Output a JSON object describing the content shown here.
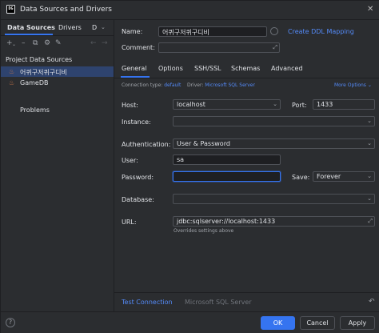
{
  "window": {
    "title": "Data Sources and Drivers",
    "app_icon_text": "DG"
  },
  "left": {
    "tabs": [
      "Data Sources",
      "Drivers",
      "D"
    ],
    "section_label": "Project Data Sources",
    "items": [
      {
        "label": "어퀴구저퀴구디비",
        "selected": true
      },
      {
        "label": "GameDB",
        "selected": false
      }
    ],
    "problems_label": "Problems"
  },
  "form": {
    "name_label": "Name:",
    "name_value": "어퀴구저퀴구디비",
    "create_ddl_link": "Create DDL Mapping",
    "comment_label": "Comment:",
    "comment_value": "",
    "tabs": [
      "General",
      "Options",
      "SSH/SSL",
      "Schemas",
      "Advanced"
    ],
    "active_tab": "General",
    "connection_type_label": "Connection type:",
    "connection_type_value": "default",
    "driver_label": "Driver:",
    "driver_value": "Microsoft SQL Server",
    "more_options": "More Options",
    "host_label": "Host:",
    "host_value": "localhost",
    "port_label": "Port:",
    "port_value": "1433",
    "instance_label": "Instance:",
    "instance_value": "",
    "auth_label": "Authentication:",
    "auth_value": "User & Password",
    "user_label": "User:",
    "user_value": "sa",
    "password_label": "Password:",
    "password_value": "",
    "save_label": "Save:",
    "save_value": "Forever",
    "database_label": "Database:",
    "database_value": "",
    "url_label": "URL:",
    "url_value": "jdbc:sqlserver://localhost:1433",
    "url_hint": "Overrides settings above",
    "test_connection": "Test Connection",
    "driver_footer": "Microsoft SQL Server"
  },
  "footer": {
    "help": "?",
    "ok": "OK",
    "cancel": "Cancel",
    "apply": "Apply"
  },
  "colors": {
    "accent": "#3574f0",
    "link": "#548af7",
    "background": "#2b2d30",
    "selection": "#2e436e"
  }
}
